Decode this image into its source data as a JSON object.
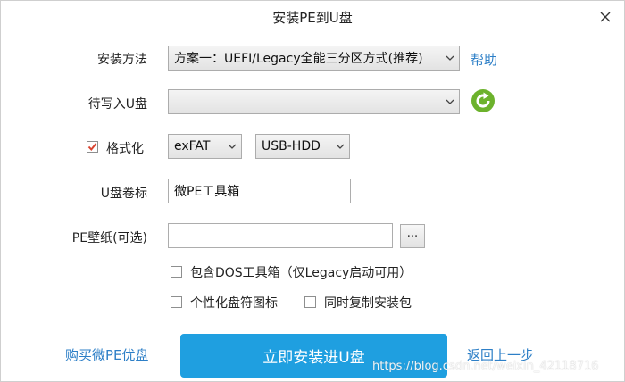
{
  "window": {
    "title": "安装PE到U盘"
  },
  "colors": {
    "accent": "#1f9fe0",
    "link": "#2d7fc7",
    "refresh": "#6cb22c",
    "check": "#d9432f"
  },
  "install_method": {
    "label": "安装方法",
    "value": "方案一：UEFI/Legacy全能三分区方式(推荐)",
    "help_link": "帮助"
  },
  "target_disk": {
    "label": "待写入U盘",
    "value": ""
  },
  "format": {
    "label": "格式化",
    "checked": true,
    "fs_value": "exFAT",
    "mode_value": "USB-HDD"
  },
  "volume_label": {
    "label": "U盘卷标",
    "value": "微PE工具箱"
  },
  "wallpaper": {
    "label": "PE壁纸(可选)",
    "value": "",
    "browse_label": "..."
  },
  "options": {
    "dos_toolbox": "包含DOS工具箱（仅Legacy启动可用）",
    "custom_icon": "个性化盘符图标",
    "copy_installer": "同时复制安装包"
  },
  "footer": {
    "buy_link": "购买微PE优盘",
    "install_button": "立即安装进U盘",
    "back_link": "返回上一步",
    "watermark": "https://blog.csdn.net/weixin_42118716"
  }
}
